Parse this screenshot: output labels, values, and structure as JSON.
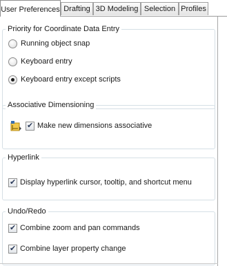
{
  "tabs": [
    {
      "label": "User Preferences",
      "active": true
    },
    {
      "label": "Drafting",
      "active": false
    },
    {
      "label": "3D Modeling",
      "active": false
    },
    {
      "label": "Selection",
      "active": false
    },
    {
      "label": "Profiles",
      "active": false
    }
  ],
  "priority": {
    "title": "Priority for Coordinate Data Entry",
    "options": [
      {
        "label": "Running object snap",
        "selected": false
      },
      {
        "label": "Keyboard entry",
        "selected": false
      },
      {
        "label": "Keyboard entry except scripts",
        "selected": true
      }
    ]
  },
  "associative": {
    "title": "Associative Dimensioning",
    "icon": "associative-dimension-icon",
    "checkbox": {
      "label": "Make new dimensions associative",
      "checked": true
    }
  },
  "hyperlink": {
    "title": "Hyperlink",
    "checkbox": {
      "label": "Display hyperlink cursor, tooltip, and shortcut menu",
      "checked": true
    }
  },
  "undo_redo": {
    "title": "Undo/Redo",
    "checkboxes": [
      {
        "label": "Combine zoom and pan commands",
        "checked": true
      },
      {
        "label": "Combine layer property change",
        "checked": true
      }
    ]
  }
}
